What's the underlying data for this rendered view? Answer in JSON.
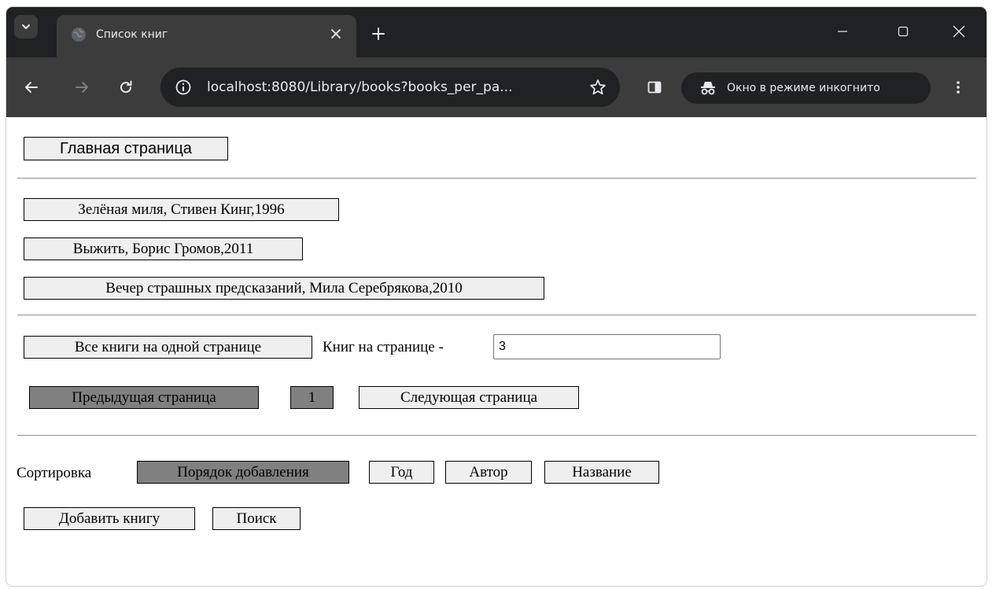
{
  "browser": {
    "tab_title": "Список книг",
    "url": "localhost:8080/Library/books?books_per_pa...",
    "incognito_label": "Окно в режиме инкогнито"
  },
  "page": {
    "home_button": "Главная страница",
    "books": [
      "Зелёная миля, Стивен Кинг,1996",
      "Выжить, Борис Громов,2011",
      "Вечер страшных предсказаний, Мила Серебрякова,2010"
    ],
    "pagination": {
      "all_books_button": "Все книги на одной странице",
      "per_page_label": "Книг на странице -",
      "per_page_value": "3",
      "prev_button": "Предыдущая страница",
      "current_page": "1",
      "next_button": "Следующая страница"
    },
    "sorting": {
      "label": "Сортировка",
      "options": [
        "Порядок добавления",
        "Год",
        "Автор",
        "Название"
      ],
      "active_option": "Порядок добавления"
    },
    "actions": {
      "add_book_button": "Добавить книгу",
      "search_button": "Поиск"
    }
  },
  "colors": {
    "active_button_bg": "#808080",
    "default_button_bg": "#efefef",
    "browser_frame": "#202124",
    "browser_toolbar": "#3c3c3c"
  }
}
